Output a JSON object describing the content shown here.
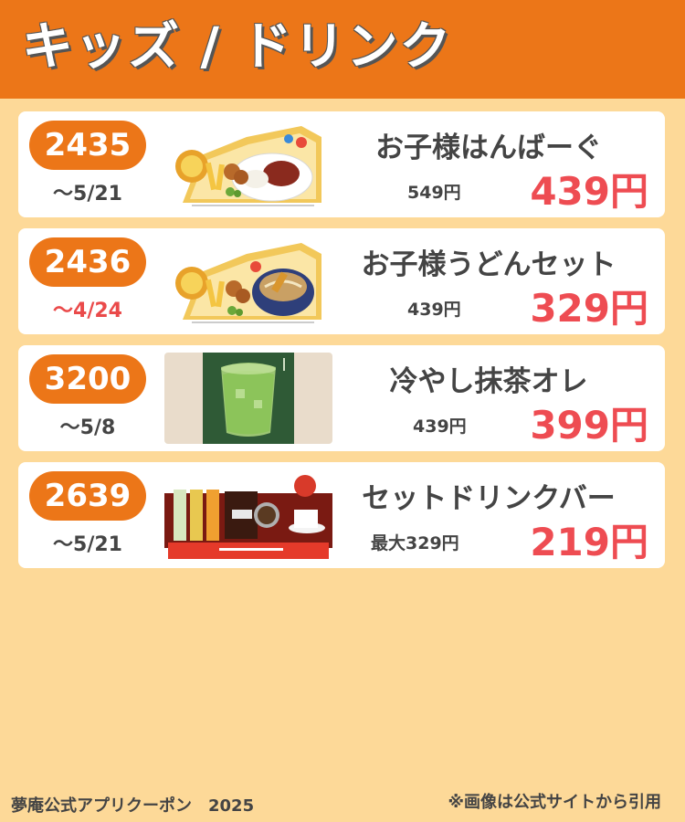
{
  "header": {
    "title": "キッズ / ドリンク"
  },
  "colors": {
    "accent": "#ec7618",
    "sale": "#ee4c52",
    "urgent": "#ea4a4a",
    "background": "#fdd998"
  },
  "coupons": [
    {
      "code": "2435",
      "deadline": "〜5/21",
      "name": "お子様はんばーぐ",
      "original_price": "549円",
      "sale_price": "439円",
      "image": "kids-hamburg-plate-image"
    },
    {
      "code": "2436",
      "deadline": "〜4/24",
      "name": "お子様うどんセット",
      "original_price": "439円",
      "sale_price": "329円",
      "image": "kids-udon-set-image"
    },
    {
      "code": "3200",
      "deadline": "〜5/8",
      "name": "冷やし抹茶オレ",
      "original_price": "439円",
      "sale_price": "399円",
      "image": "iced-matcha-latte-image"
    },
    {
      "code": "2639",
      "deadline": "〜5/21",
      "name": "セットドリンクバー",
      "original_price": "最大329円",
      "sale_price": "219円",
      "image": "drink-bar-image"
    }
  ],
  "footer": {
    "left": "夢庵公式アプリクーポン　2025",
    "right": "※画像は公式サイトから引用"
  }
}
